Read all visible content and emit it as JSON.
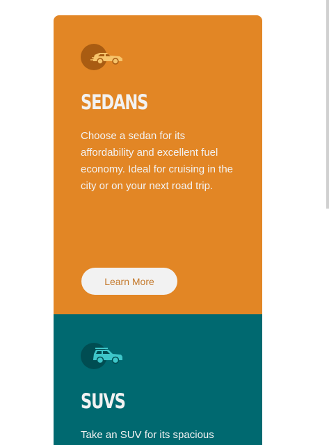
{
  "colors": {
    "sedans_bg": "#e28625",
    "suvs_bg": "#006970",
    "light_text": "#f2f2f2",
    "button_bg": "#f2f2f2",
    "button_text": "#c4792c",
    "page_bg": "#ffffff"
  },
  "cards": {
    "sedans": {
      "icon": "sedan-car-icon",
      "title": "SEDANS",
      "text": "Choose a sedan for its affordability and excellent fuel economy. Ideal for cruising in the city or on your next road trip.",
      "button_label": "Learn More"
    },
    "suvs": {
      "icon": "suv-car-icon",
      "title": "SUVS",
      "text": "Take an SUV for its spacious"
    }
  }
}
